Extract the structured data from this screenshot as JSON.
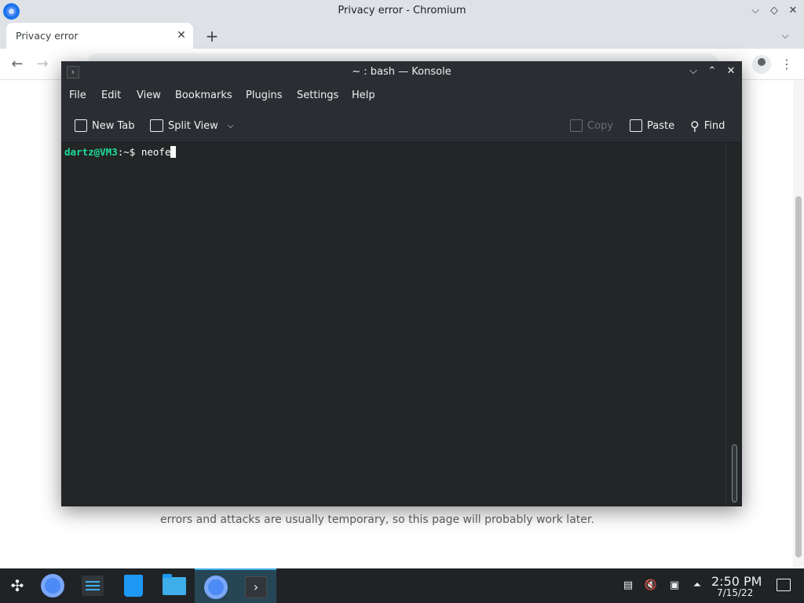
{
  "chromium": {
    "window_title": "Privacy error - Chromium",
    "tab": {
      "label": "Privacy error",
      "close_glyph": "✕"
    },
    "new_tab_glyph": "+",
    "tab_search_glyph": "⌵",
    "nav": {
      "back_glyph": "←",
      "forward_glyph": "→"
    },
    "menu_glyph": "⋮",
    "page_text": "errors and attacks are usually temporary, so this page will probably work later.",
    "window_controls": {
      "minimize": "⌵",
      "maximize": "◇",
      "close": "✕"
    }
  },
  "konsole": {
    "title": "~ : bash — Konsole",
    "window_controls": {
      "minimize": "⌵",
      "maximize": "⌃",
      "close": "✕"
    },
    "menu": [
      "File",
      "Edit",
      "View",
      "Bookmarks",
      "Plugins",
      "Settings",
      "Help"
    ],
    "toolbar": {
      "new_tab": "New Tab",
      "split_view": "Split View",
      "copy": "Copy",
      "paste": "Paste",
      "find": "Find"
    },
    "terminal": {
      "user_host": "dartz@VM3",
      "path_prompt": ":~$ ",
      "command": "neofe"
    }
  },
  "taskbar": {
    "time": "2:50 PM",
    "date": "7/15/22",
    "tray_up_glyph": "⏶"
  },
  "colors": {
    "konsole_bg": "#232627",
    "prompt_user": "#1cdc9a",
    "taskbar_bg": "#1f2326",
    "accent": "#3daee9"
  }
}
